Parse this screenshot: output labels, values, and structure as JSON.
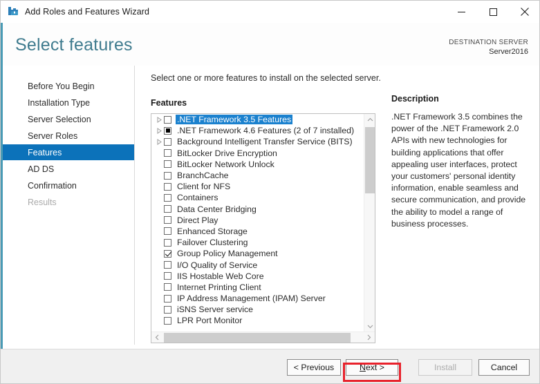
{
  "window": {
    "title": "Add Roles and Features Wizard",
    "icon": "roles-features-wizard-icon",
    "controls": {
      "minimize": "minimize-icon",
      "maximize": "maximize-icon",
      "close": "close-icon"
    }
  },
  "header": {
    "page_title": "Select features",
    "destination_label": "DESTINATION SERVER",
    "destination_server": "Server2016",
    "accent_color": "#4a9bb5",
    "title_color": "#3f7b8e"
  },
  "sidebar": {
    "active_color": "#0c72ba",
    "items": [
      {
        "label": "Before You Begin",
        "state": "normal"
      },
      {
        "label": "Installation Type",
        "state": "normal"
      },
      {
        "label": "Server Selection",
        "state": "normal"
      },
      {
        "label": "Server Roles",
        "state": "normal"
      },
      {
        "label": "Features",
        "state": "active"
      },
      {
        "label": "AD DS",
        "state": "normal"
      },
      {
        "label": "Confirmation",
        "state": "normal"
      },
      {
        "label": "Results",
        "state": "disabled"
      }
    ]
  },
  "main": {
    "instruction": "Select one or more features to install on the selected server.",
    "features_label": "Features",
    "selection_color": "#1b81ce",
    "features": [
      {
        "label": ".NET Framework 3.5 Features",
        "checkbox": "unchecked",
        "expandable": true,
        "selected": true
      },
      {
        "label": ".NET Framework 4.6 Features (2 of 7 installed)",
        "checkbox": "partial",
        "expandable": true,
        "selected": false
      },
      {
        "label": "Background Intelligent Transfer Service (BITS)",
        "checkbox": "unchecked",
        "expandable": true,
        "selected": false
      },
      {
        "label": "BitLocker Drive Encryption",
        "checkbox": "unchecked",
        "expandable": false,
        "selected": false
      },
      {
        "label": "BitLocker Network Unlock",
        "checkbox": "unchecked",
        "expandable": false,
        "selected": false
      },
      {
        "label": "BranchCache",
        "checkbox": "unchecked",
        "expandable": false,
        "selected": false
      },
      {
        "label": "Client for NFS",
        "checkbox": "unchecked",
        "expandable": false,
        "selected": false
      },
      {
        "label": "Containers",
        "checkbox": "unchecked",
        "expandable": false,
        "selected": false
      },
      {
        "label": "Data Center Bridging",
        "checkbox": "unchecked",
        "expandable": false,
        "selected": false
      },
      {
        "label": "Direct Play",
        "checkbox": "unchecked",
        "expandable": false,
        "selected": false
      },
      {
        "label": "Enhanced Storage",
        "checkbox": "unchecked",
        "expandable": false,
        "selected": false
      },
      {
        "label": "Failover Clustering",
        "checkbox": "unchecked",
        "expandable": false,
        "selected": false
      },
      {
        "label": "Group Policy Management",
        "checkbox": "checked",
        "expandable": false,
        "selected": false
      },
      {
        "label": "I/O Quality of Service",
        "checkbox": "unchecked",
        "expandable": false,
        "selected": false
      },
      {
        "label": "IIS Hostable Web Core",
        "checkbox": "unchecked",
        "expandable": false,
        "selected": false
      },
      {
        "label": "Internet Printing Client",
        "checkbox": "unchecked",
        "expandable": false,
        "selected": false
      },
      {
        "label": "IP Address Management (IPAM) Server",
        "checkbox": "unchecked",
        "expandable": false,
        "selected": false
      },
      {
        "label": "iSNS Server service",
        "checkbox": "unchecked",
        "expandable": false,
        "selected": false
      },
      {
        "label": "LPR Port Monitor",
        "checkbox": "unchecked",
        "expandable": false,
        "selected": false
      }
    ]
  },
  "description": {
    "title": "Description",
    "text": ".NET Framework 3.5 combines the power of the .NET Framework 2.0 APIs with new technologies for building applications that offer appealing user interfaces, protect your customers' personal identity information, enable seamless and secure communication, and provide the ability to model a range of business processes."
  },
  "footer": {
    "previous": "< Previous",
    "next_prefix": "",
    "next_accel": "N",
    "next_suffix": "ext >",
    "install": "Install",
    "cancel": "Cancel",
    "install_enabled": false,
    "highlight_color": "#e8212b",
    "highlighted_button": "next-button"
  }
}
